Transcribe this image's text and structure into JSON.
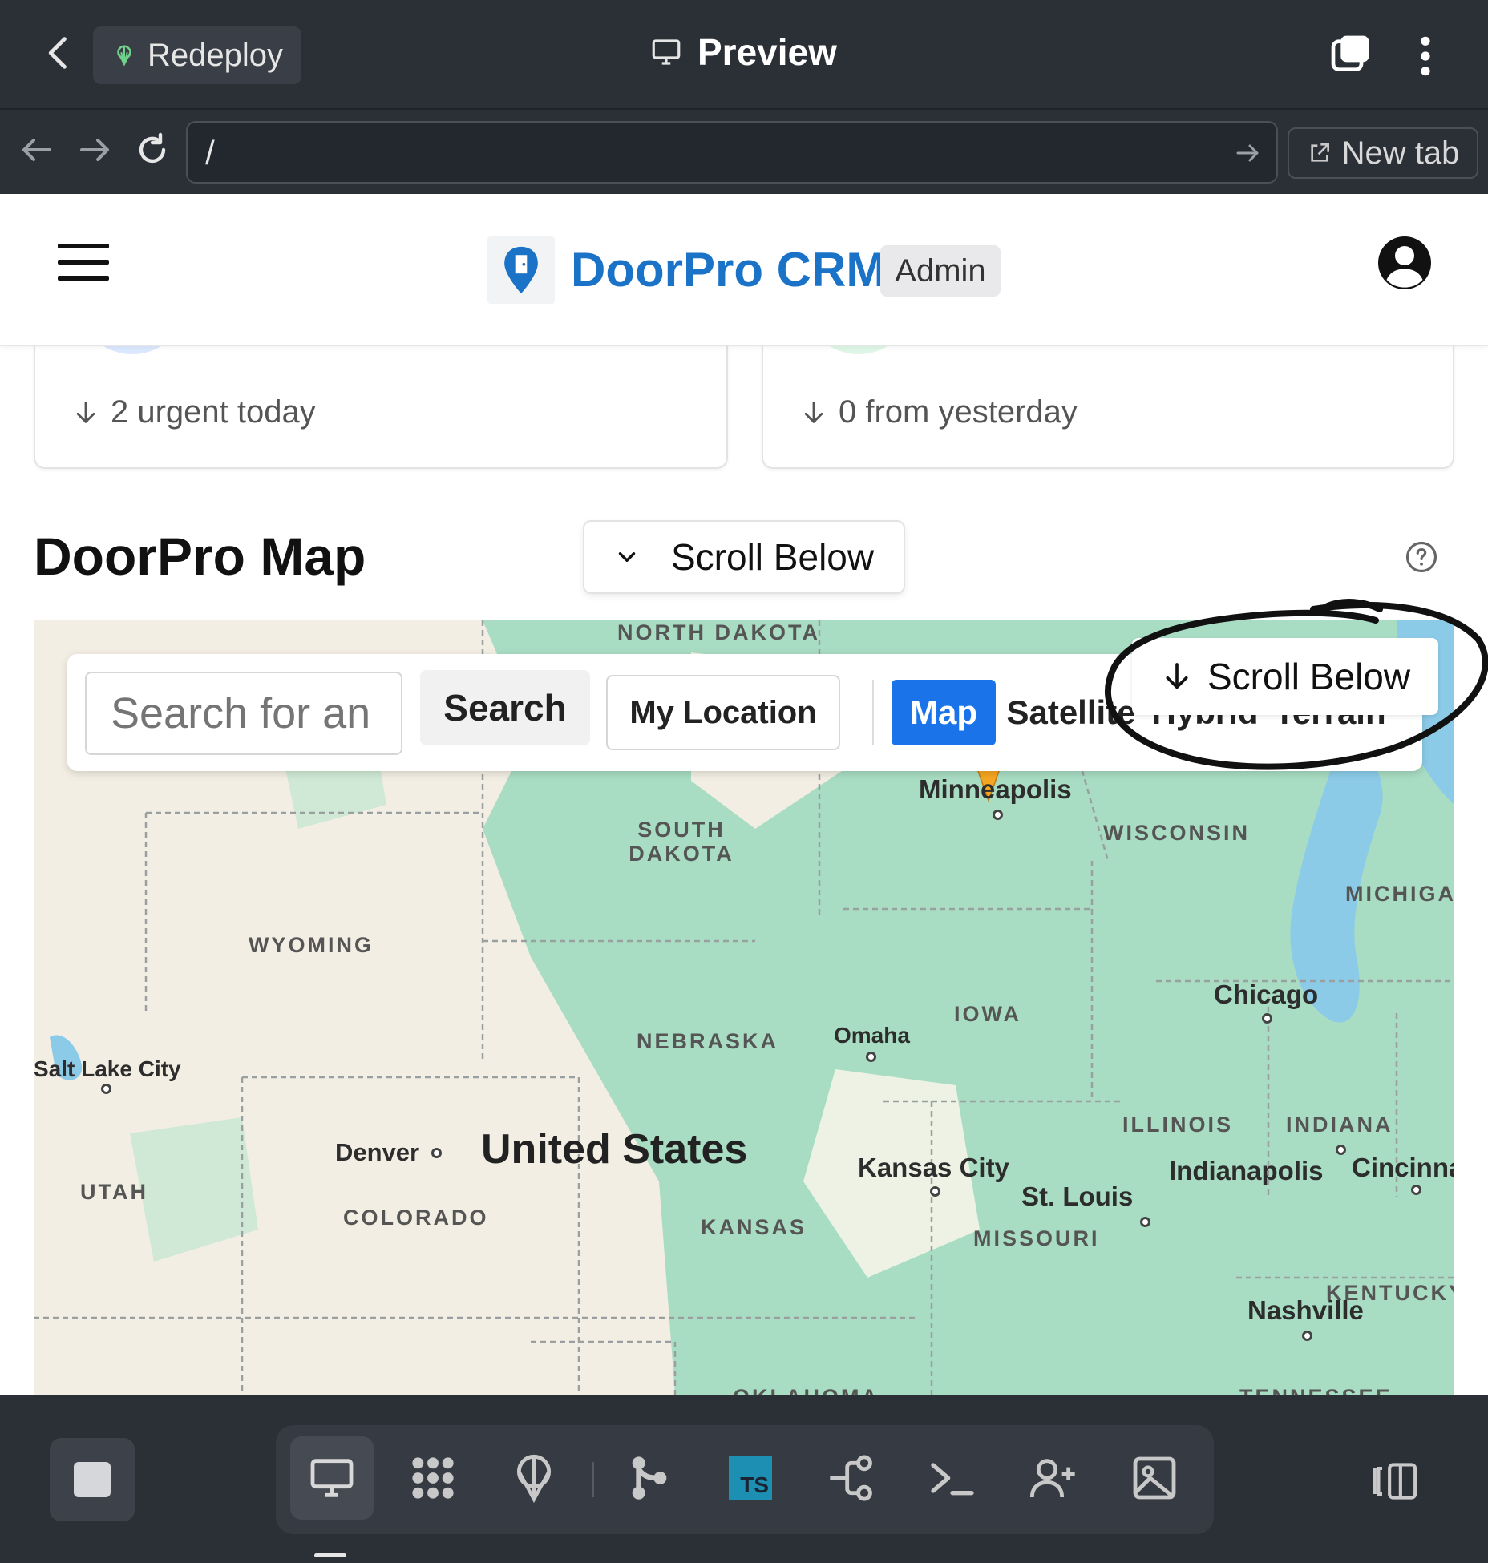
{
  "topbar": {
    "redeploy_label": "Redeploy",
    "title": "Preview"
  },
  "urlbar": {
    "url": "/",
    "new_tab_label": "New tab"
  },
  "header": {
    "brand": "DoorPro CRM",
    "badge": "Admin"
  },
  "stats": [
    {
      "delta_text": "2 urgent today",
      "accent": "#dbe8ff"
    },
    {
      "delta_text": "0 from yesterday",
      "accent": "#dff6e6"
    }
  ],
  "map_section": {
    "title": "DoorPro Map",
    "scroll_button_label": "Scroll Below",
    "overlay_scroll_label": "Scroll Below",
    "search_placeholder": "Search for an",
    "search_button": "Search",
    "my_location_button": "My Location",
    "map_types": [
      "Map",
      "Satellite",
      "Hybrid",
      "Terrain"
    ],
    "active_map_type": "Map"
  },
  "map_labels": {
    "states": [
      "NORTH DAKOTA",
      "SOUTH DAKOTA",
      "WYOMING",
      "NEBRASKA",
      "IOWA",
      "WISCONSIN",
      "MICHIGAN",
      "ILLINOIS",
      "INDIANA",
      "UTAH",
      "COLORADO",
      "KANSAS",
      "MISSOURI",
      "KENTUCKY",
      "OKLAHOMA",
      "TENNESSEE"
    ],
    "cities": [
      "Minneapolis",
      "Chicago",
      "Omaha",
      "Salt Lake City",
      "Denver",
      "Kansas City",
      "St. Louis",
      "Indianapolis",
      "Cincinnati",
      "Nashville"
    ],
    "country": "United States"
  },
  "colors": {
    "topbar_bg": "#2b2f36",
    "brand_blue": "#1a73c7",
    "map_active": "#1a73e8",
    "map_water": "#8ccbe8",
    "map_green": "#a8dcc3",
    "map_land": "#f2eee3"
  },
  "icons": {
    "topbar": [
      "chevron-left-icon",
      "deploy-icon",
      "monitor-icon",
      "tabs-icon",
      "kebab-icon"
    ],
    "urlbar": [
      "arrow-left-icon",
      "arrow-right-icon",
      "refresh-icon",
      "go-arrow-icon",
      "external-link-icon"
    ],
    "bottombar": [
      "stop-icon",
      "monitor-icon",
      "apps-icon",
      "deploy-icon",
      "git-icon",
      "typescript-icon",
      "workflow-icon",
      "terminal-icon",
      "add-user-icon",
      "image-icon",
      "panel-icon"
    ]
  }
}
